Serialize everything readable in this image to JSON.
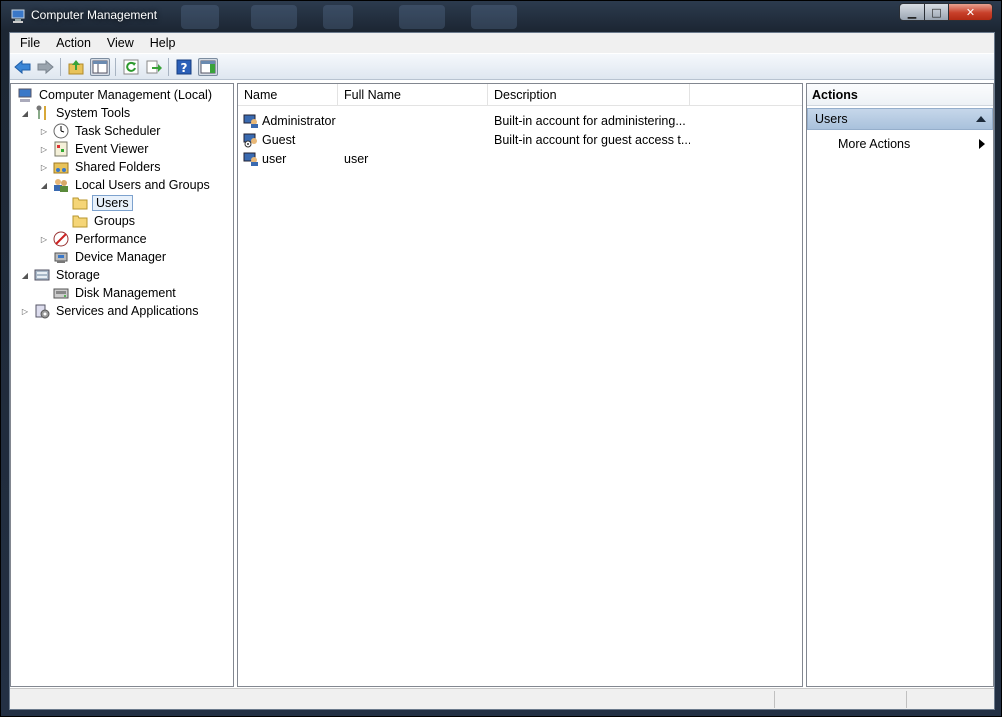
{
  "window": {
    "title": "Computer Management",
    "icon": "computer-management-icon",
    "controls": {
      "minimize": "▁",
      "maximize": "□",
      "close": "✕"
    }
  },
  "menu": [
    "File",
    "Action",
    "View",
    "Help"
  ],
  "toolbar": {
    "buttons": [
      "back-arrow-icon",
      "forward-arrow-icon",
      "up-folder-icon",
      "show-hide-console-tree-icon",
      "refresh-icon",
      "export-list-icon",
      "help-icon",
      "show-hide-action-pane-icon"
    ]
  },
  "tree": {
    "items": [
      {
        "label": "Computer Management (Local)",
        "icon": "computer-icon",
        "level": 0,
        "expander": "none"
      },
      {
        "label": "System Tools",
        "icon": "tools-icon",
        "level": 1,
        "expander": "expanded"
      },
      {
        "label": "Task Scheduler",
        "icon": "clock-icon",
        "level": 2,
        "expander": "collapsed"
      },
      {
        "label": "Event Viewer",
        "icon": "event-viewer-icon",
        "level": 2,
        "expander": "collapsed"
      },
      {
        "label": "Shared Folders",
        "icon": "shared-folder-icon",
        "level": 2,
        "expander": "collapsed"
      },
      {
        "label": "Local Users and Groups",
        "icon": "users-group-icon",
        "level": 2,
        "expander": "expanded"
      },
      {
        "label": "Users",
        "icon": "folder-icon",
        "level": 3,
        "expander": "none",
        "selected": true
      },
      {
        "label": "Groups",
        "icon": "folder-icon",
        "level": 3,
        "expander": "none"
      },
      {
        "label": "Performance",
        "icon": "performance-icon",
        "level": 2,
        "expander": "collapsed"
      },
      {
        "label": "Device Manager",
        "icon": "device-manager-icon",
        "level": 2,
        "expander": "none"
      },
      {
        "label": "Storage",
        "icon": "storage-icon",
        "level": 1,
        "expander": "expanded"
      },
      {
        "label": "Disk Management",
        "icon": "disk-icon",
        "level": 2,
        "expander": "none"
      },
      {
        "label": "Services and Applications",
        "icon": "services-icon",
        "level": 1,
        "expander": "collapsed"
      }
    ]
  },
  "list": {
    "columns": [
      "Name",
      "Full Name",
      "Description"
    ],
    "rows": [
      {
        "name": "Administrator",
        "full_name": "",
        "description": "Built-in account for administering..."
      },
      {
        "name": "Guest",
        "full_name": "",
        "description": "Built-in account for guest access t..."
      },
      {
        "name": "user",
        "full_name": "user",
        "description": ""
      }
    ]
  },
  "actions": {
    "title": "Actions",
    "section": "Users",
    "items": [
      "More Actions"
    ]
  },
  "colors": {
    "accent": "#a9c1dc",
    "selection": "#e8f1fb"
  }
}
